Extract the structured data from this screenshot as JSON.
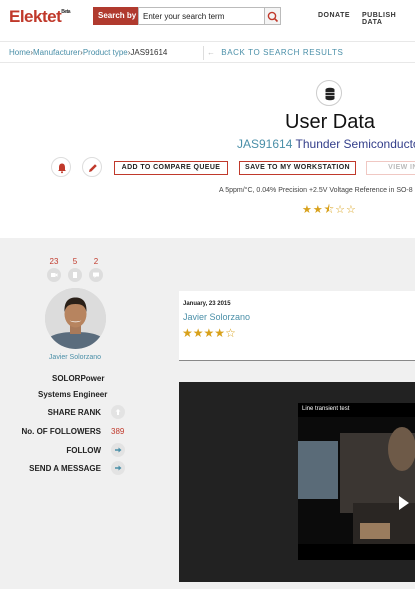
{
  "header": {
    "logo": "Elektet",
    "logo_badge": "Beta",
    "search_label": "Search by",
    "search_placeholder": "Enter your search term",
    "nav": [
      "DONATE",
      "PUBLISH DATA"
    ]
  },
  "breadcrumb": {
    "items": [
      "Home",
      "Manufacturer",
      "Product type"
    ],
    "current": "JAS91614",
    "back_label": "BACK TO SEARCH RESULTS"
  },
  "product": {
    "title": "User Data",
    "code": "JAS91614",
    "manufacturer": "Thunder Semiconductor",
    "description": "A 5ppm/°C, 0.04% Precision +2.5V Voltage Reference in SO-8",
    "rating": 2.5,
    "rating_stars": [
      "★",
      "★",
      "⯪",
      "☆",
      "☆"
    ],
    "actions": {
      "compare": "ADD TO COMPARE QUEUE",
      "workstation": "SAVE TO MY WORKSTATION",
      "view": "VIEW IN"
    }
  },
  "profile": {
    "stats": [
      "23",
      "5",
      "2"
    ],
    "name": "Javier Solorzano",
    "company": "SOLORPower",
    "role": "Systems Engineer",
    "share_rank_label": "SHARE RANK",
    "followers_label": "No. OF FOLLOWERS",
    "followers_count": "389",
    "follow_label": "FOLLOW",
    "message_label": "SEND A MESSAGE"
  },
  "review": {
    "date": "January, 23 2015",
    "author": "Javier Solorzano",
    "rating": 4,
    "stars": [
      "★",
      "★",
      "★",
      "★",
      "☆"
    ]
  },
  "video": {
    "title": "Line transient test"
  },
  "colors": {
    "brand_red": "#c0392b",
    "link_blue": "#4a8fa8",
    "manufacturer_purple": "#333e8a",
    "star_gold": "#d8a11b"
  }
}
